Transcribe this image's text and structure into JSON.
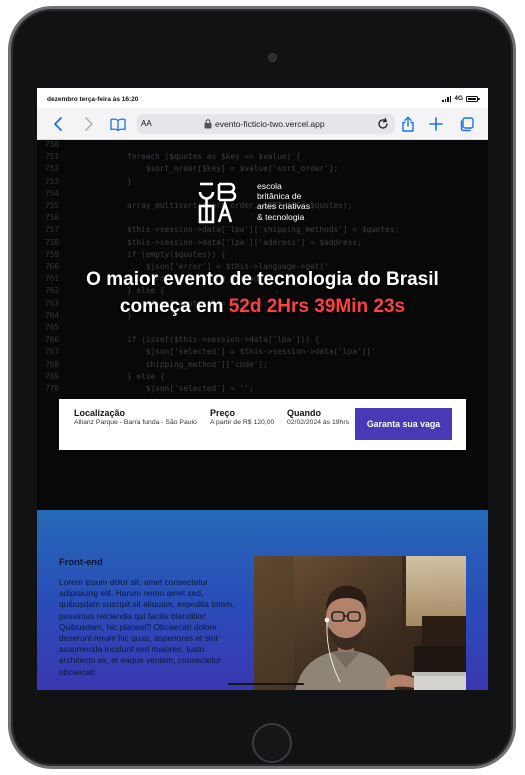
{
  "status_bar": {
    "datetime": "dezembro terça-feira às 16:20",
    "network": "4G"
  },
  "browser": {
    "text_size_label": "AA",
    "url": "evento-ficticio-two.vercel.app",
    "icons": {
      "back": "chevron-left-icon",
      "forward": "chevron-right-icon",
      "bookmarks": "book-icon",
      "lock": "lock-icon",
      "reload": "reload-icon",
      "share": "share-icon",
      "new_tab": "plus-icon",
      "tabs": "tabs-icon"
    }
  },
  "hero": {
    "logo_lines": [
      "escola",
      "britânica de",
      "artes criativas",
      "& tecnologia"
    ],
    "title_part1": "O maior evento de tecnologia do Brasil começa em",
    "countdown": "52d 2Hrs 39Min 23s",
    "code_lines": [
      {
        "n": "750",
        "t": ""
      },
      {
        "n": "751",
        "t": "foreach ($quotes as $key => $value) {"
      },
      {
        "n": "752",
        "t": "    $sort_order[$key] = $value['sort_order'];"
      },
      {
        "n": "753",
        "t": "}"
      },
      {
        "n": "754",
        "t": ""
      },
      {
        "n": "755",
        "t": "array_multisort($sort_order, SORT_ASC, $quotes);"
      },
      {
        "n": "756",
        "t": ""
      },
      {
        "n": "757",
        "t": "$this->session->data['lpa']['shipping_methods'] = $quotes;"
      },
      {
        "n": "758",
        "t": "$this->session->data['lpa']['address'] = $address;"
      },
      {
        "n": "759",
        "t": "if (empty($quotes)) {"
      },
      {
        "n": "760",
        "t": "    $json['error'] = $this->language->get('"
      },
      {
        "n": "761",
        "t": "    error_no_shipping_methods');"
      },
      {
        "n": "762",
        "t": "} else {"
      },
      {
        "n": "763",
        "t": "    $json['quotes'] = $quotes;"
      },
      {
        "n": "764",
        "t": "}"
      },
      {
        "n": "765",
        "t": ""
      },
      {
        "n": "766",
        "t": "if (isset($this->session->data['lpa'])) {"
      },
      {
        "n": "767",
        "t": "    $json['selected'] = $this->session->data['lpa']['"
      },
      {
        "n": "768",
        "t": "    shipping_method']['code'];"
      },
      {
        "n": "769",
        "t": "} else {"
      },
      {
        "n": "770",
        "t": "    $json['selected'] = '';"
      }
    ]
  },
  "event_info": {
    "location_label": "Localização",
    "location_value": "Allianz Parque - Barra funda - São Paulo",
    "price_label": "Preço",
    "price_value": "A partir de R$ 120,00",
    "date_label": "Quando",
    "date_value": "02/02/2024 às 19hrs",
    "cta_label": "Garanta sua vaga"
  },
  "section": {
    "title": "Front-end",
    "body": "Lorem ipsum dolor sit, amet consectetur adipisicing elit. Harum nemo amet sed, quibusdam suscipit sit aliquam, expedita totam, possimus reiciendis qui facilis blanditiis! Quibusdam, hic placeat? Obcaecati dolore deserunt rerum hic quas, asperiores et sint assumenda incidunt sed maiores. Iusto architecto ex, et eaque veniam, consectetur obcaecati"
  },
  "colors": {
    "cta": "#4a39b6",
    "countdown": "#ff4040",
    "section_top": "#2569b8",
    "section_bottom": "#3a37b0"
  }
}
